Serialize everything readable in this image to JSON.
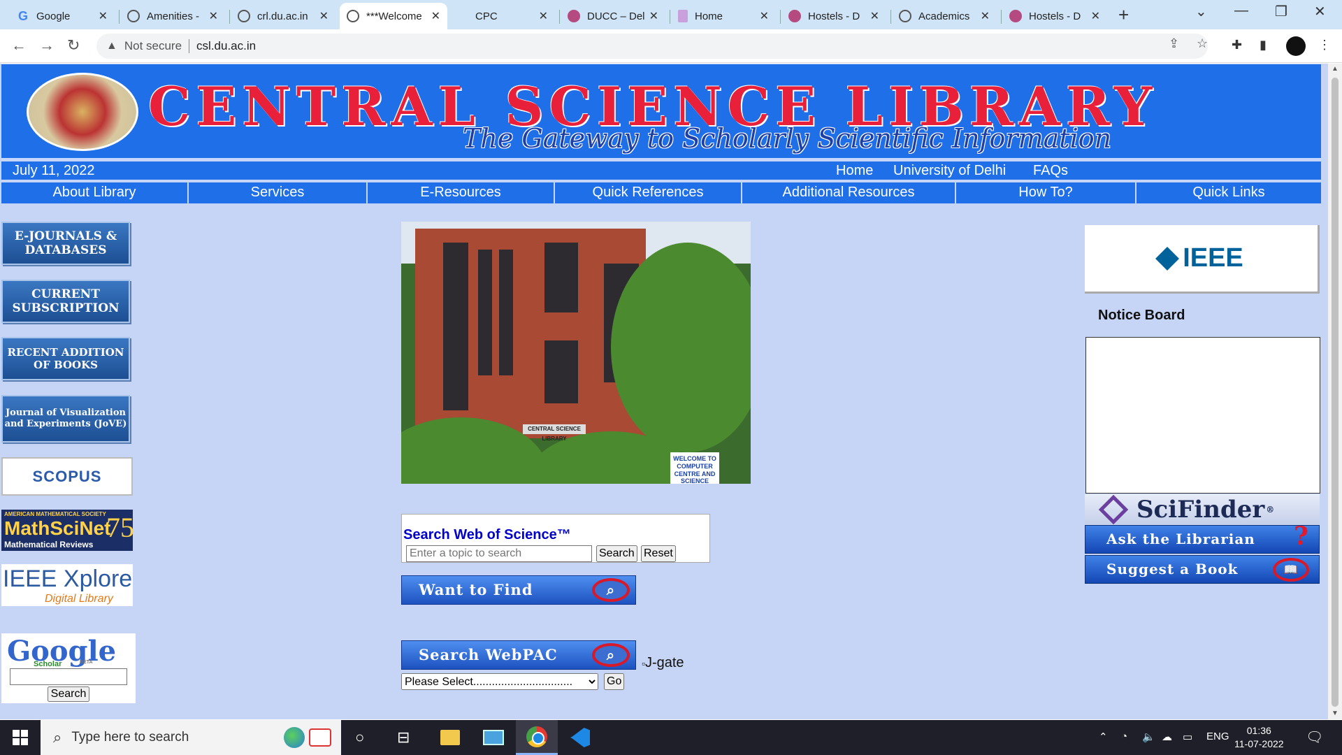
{
  "browser": {
    "tabs": [
      {
        "title": "Google",
        "icon": "google-icon"
      },
      {
        "title": "Amenities -",
        "icon": "globe-icon"
      },
      {
        "title": "crl.du.ac.in",
        "icon": "globe-icon"
      },
      {
        "title": "***Welcome",
        "icon": "globe-icon",
        "active": true
      },
      {
        "title": "CPC",
        "icon": "blank-icon"
      },
      {
        "title": "DUCC – Del",
        "icon": "du-icon"
      },
      {
        "title": "Home",
        "icon": "doc-icon"
      },
      {
        "title": "Hostels - D",
        "icon": "du-icon"
      },
      {
        "title": "Academics",
        "icon": "globe-icon"
      },
      {
        "title": "Hostels - D",
        "icon": "du-icon"
      }
    ],
    "security_label": "Not secure",
    "url": "csl.du.ac.in"
  },
  "site": {
    "banner_title": "CENTRAL SCIENCE LIBRARY",
    "banner_subtitle": "The Gateway to Scholarly Scientific Information",
    "date": "July 11, 2022",
    "top_links": [
      "Home",
      "University of Delhi",
      "FAQs"
    ],
    "menu": [
      "About Library",
      "Services",
      "E-Resources",
      "Quick References",
      "Additional Resources",
      "How To?",
      "Quick Links"
    ]
  },
  "left": {
    "buttons": [
      "E-JOURNALS & DATABASES",
      "CURRENT SUBSCRIPTION",
      "RECENT ADDITION OF BOOKS",
      "Journal of Visualization and Experiments (JoVE)"
    ],
    "scopus": "SCOPUS",
    "mathscinet_top": "AMERICAN MATHEMATICAL SOCIETY",
    "mathscinet": "MathSciNet",
    "mathscinet_sub": "Mathematical Reviews",
    "mathscinet_badge": "75",
    "ieee_xplore": "IEEE Xplore",
    "ieee_xplore_sub": "Digital Library",
    "scholar_logo": "Google",
    "scholar_sub": "Scholar",
    "scholar_beta": "BETA",
    "scholar_search": "Search"
  },
  "center": {
    "photo_plate": "CENTRAL SCIENCE LIBRARY",
    "photo_sign": "WELCOME TO COMPUTER CENTRE AND SCIENCE LIBRARY",
    "wos_title": "Search Web of Science™",
    "wos_placeholder": "Enter a topic to search",
    "wos_search": "Search",
    "wos_reset": "Reset",
    "want_to_find": "Want to Find",
    "jgate_alt": "J-gate",
    "select_value": "Please Select................................",
    "go": "Go",
    "webpac": "Search WebPAC"
  },
  "right": {
    "ieee": "IEEE",
    "notice_board": "Notice Board",
    "scifinder": "SciFinder",
    "scifinder_mark": "®",
    "ask": "Ask the Librarian",
    "suggest": "Suggest a Book"
  },
  "taskbar": {
    "search_placeholder": "Type here to search",
    "lang": "ENG",
    "time": "01:36",
    "date": "11-07-2022"
  },
  "colors": {
    "page_bg": "#c6d5f6",
    "banner_blue": "#1e6fe8",
    "banner_red": "#e8203a"
  }
}
